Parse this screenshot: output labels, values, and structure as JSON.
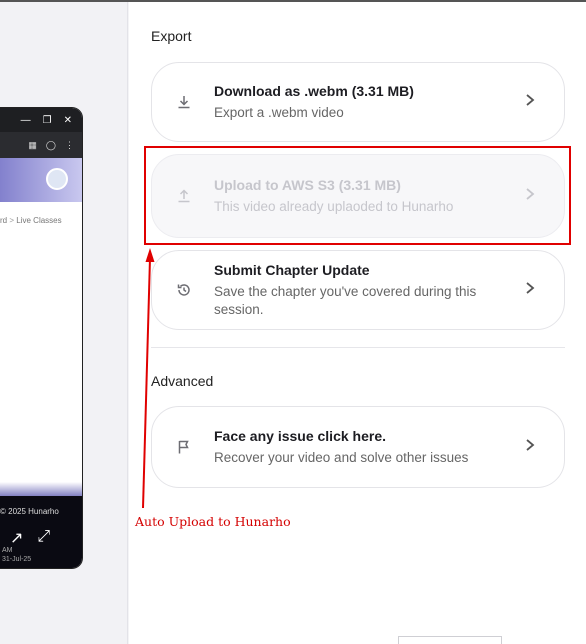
{
  "preview": {
    "crumb_prev": "rd",
    "crumb_sep": ">",
    "crumb_current": "Live Classes",
    "copyright": "© 2025 Hunarho",
    "meta_line1": "AM",
    "meta_line2": "31-Jul-25"
  },
  "export": {
    "heading": "Export",
    "items": [
      {
        "title": "Download as .webm (3.31 MB)",
        "subtitle": "Export a .webm video",
        "icon": "download-icon",
        "enabled": true
      },
      {
        "title": "Upload to AWS S3 (3.31 MB)",
        "subtitle": "This video already uplaoded to Hunarho",
        "icon": "upload-icon",
        "enabled": false
      },
      {
        "title": "Submit Chapter Update",
        "subtitle": "Save the chapter you've covered during this session.",
        "icon": "history-icon",
        "enabled": true
      }
    ]
  },
  "advanced": {
    "heading": "Advanced",
    "items": [
      {
        "title": "Face any issue click here.",
        "subtitle": "Recover your video and solve other issues",
        "icon": "flag-icon",
        "enabled": true
      }
    ]
  },
  "annotation": {
    "label": "Auto Upload to Hunarho",
    "color": "#d40000"
  }
}
